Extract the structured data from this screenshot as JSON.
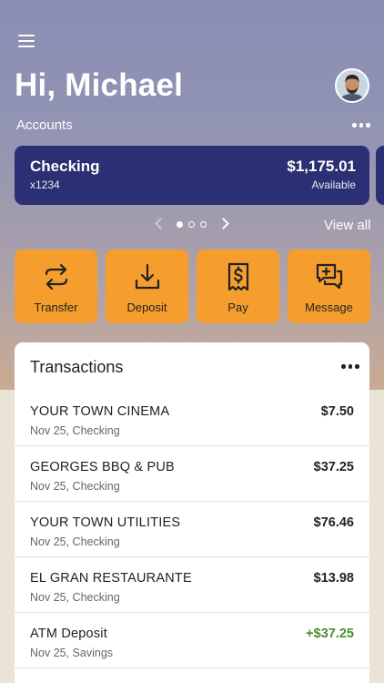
{
  "header": {
    "greeting": "Hi, Michael"
  },
  "accounts": {
    "label": "Accounts",
    "cards": [
      {
        "name": "Checking",
        "number": "x1234",
        "balance": "$1,175.01",
        "balance_label": "Available"
      }
    ],
    "view_all": "View all"
  },
  "actions": [
    {
      "label": "Transfer",
      "icon": "transfer-icon"
    },
    {
      "label": "Deposit",
      "icon": "deposit-icon"
    },
    {
      "label": "Pay",
      "icon": "pay-icon"
    },
    {
      "label": "Message",
      "icon": "message-icon"
    }
  ],
  "transactions": {
    "title": "Transactions",
    "items": [
      {
        "merchant": "YOUR TOWN CINEMA",
        "meta": "Nov 25, Checking",
        "amount": "$7.50"
      },
      {
        "merchant": "GEORGES BBQ & PUB",
        "meta": "Nov 25, Checking",
        "amount": "$37.25"
      },
      {
        "merchant": "YOUR TOWN UTILITIES",
        "meta": "Nov 25, Checking",
        "amount": "$76.46"
      },
      {
        "merchant": "EL GRAN RESTAURANTE",
        "meta": "Nov 25, Checking",
        "amount": "$13.98"
      },
      {
        "merchant": "ATM Deposit",
        "meta": "Nov 25, Savings",
        "amount": "+$37.25"
      }
    ]
  },
  "colors": {
    "accent": "#f59e2e",
    "card": "#2b2f73",
    "credit": "#4a8f2b"
  }
}
